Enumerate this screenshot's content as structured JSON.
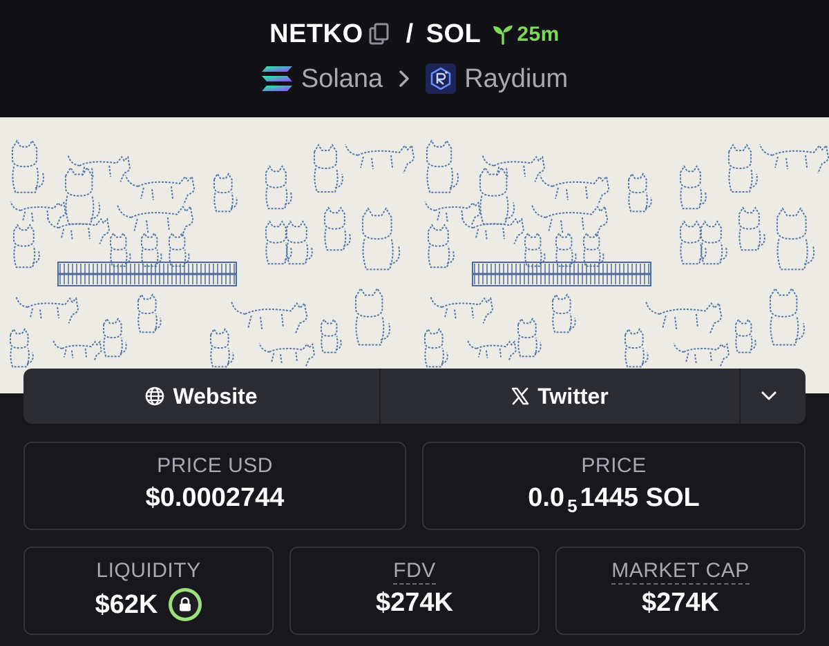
{
  "header": {
    "base_token": "NETKO",
    "separator": "/",
    "quote_token": "SOL",
    "age": "25m",
    "chain": "Solana",
    "dex": "Raydium"
  },
  "links": {
    "website_label": "Website",
    "twitter_label": "Twitter"
  },
  "stats": {
    "price_usd_label": "PRICE USD",
    "price_usd_value": "$0.0002744",
    "price_label": "PRICE",
    "price_prefix": "0.0",
    "price_zero_count": "5",
    "price_digits": "1445 SOL",
    "liquidity_label": "LIQUIDITY",
    "liquidity_value": "$62K",
    "fdv_label": "FDV",
    "fdv_value": "$274K",
    "market_cap_label": "MARKET CAP",
    "market_cap_value": "$274K"
  },
  "colors": {
    "accent_green": "#7ed957",
    "background": "#17171c",
    "header": "#121216",
    "banner": "#ecebe5",
    "button": "#2c2c33"
  }
}
